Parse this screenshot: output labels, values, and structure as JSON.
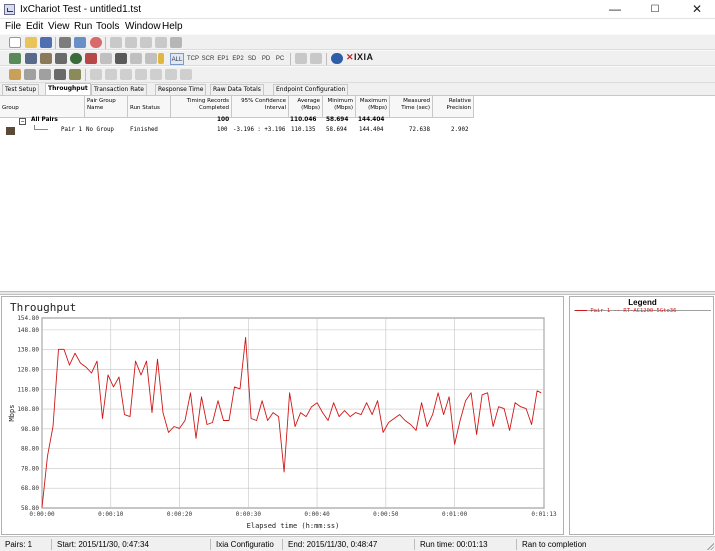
{
  "window": {
    "title": "IxChariot Test - untitled1.tst",
    "minimize": "—",
    "maximize": "☐",
    "close": "✕"
  },
  "menu": [
    "File",
    "Edit",
    "View",
    "Run",
    "Tools",
    "Window",
    "Help"
  ],
  "toolbar2": {
    "protocols": [
      "ALL",
      "TCP",
      "SCR",
      "EP1",
      "EP2",
      "SD",
      "PD",
      "PC"
    ],
    "brand": "IXIA"
  },
  "tabs": [
    "Test Setup",
    "Throughput",
    "Transaction Rate",
    "Response Time",
    "Raw Data Totals",
    "Endpoint Configuration"
  ],
  "table": {
    "headers": {
      "group": "Group",
      "pair_group_name": [
        "Pair Group",
        "Name"
      ],
      "run_status": "Run Status",
      "timing_records": [
        "Timing Records",
        "Completed"
      ],
      "confidence": [
        "95% Confidence",
        "Interval"
      ],
      "average": [
        "Average",
        "(Mbps)"
      ],
      "minimum": [
        "Minimum",
        "(Mbps)"
      ],
      "maximum": [
        "Maximum",
        "(Mbps)"
      ],
      "measured_time": [
        "Measured",
        "Time (sec)"
      ],
      "relative_precision": [
        "Relative",
        "Precision"
      ]
    },
    "all_pairs": {
      "label": "All Pairs",
      "timing_records": "100",
      "average": "110.046",
      "minimum": "58.694",
      "maximum": "144.404"
    },
    "rows": [
      {
        "group": "Pair 1",
        "pair_group_name": "No Group",
        "run_status": "Finished",
        "timing_records": "100",
        "confidence": "-3.196 : +3.196",
        "average": "110.135",
        "minimum": "58.694",
        "maximum": "144.404",
        "measured_time": "72.638",
        "relative_precision": "2.902"
      }
    ]
  },
  "chart_data": {
    "type": "line",
    "title": "Throughput",
    "xlabel": "Elapsed time (h:mm:ss)",
    "ylabel": "Mbps",
    "ylim": [
      58.8,
      154.8
    ],
    "yticks": [
      "58.80",
      "68.80",
      "78.80",
      "88.80",
      "98.80",
      "108.80",
      "118.80",
      "128.80",
      "138.80",
      "148.80",
      "154.80"
    ],
    "ytick_values": [
      58.8,
      68.8,
      78.8,
      88.8,
      98.8,
      108.8,
      118.8,
      128.8,
      138.8,
      148.8,
      154.8
    ],
    "xlim": [
      0,
      73
    ],
    "xticks": [
      "0:00:00",
      "0:00:10",
      "0:00:20",
      "0:00:30",
      "0:00:40",
      "0:00:50",
      "0:01:00",
      "0:01:13"
    ],
    "xtick_values": [
      0,
      10,
      20,
      30,
      40,
      50,
      60,
      73
    ],
    "grid": true,
    "line_color": "#d01818",
    "series": [
      {
        "name": "Pair 1 -- RT-AC1200-5G-to-36",
        "x": [
          0,
          0.8,
          1.6,
          2.4,
          3.2,
          4,
          4.8,
          5.6,
          6.4,
          7.2,
          8,
          8.8,
          9.6,
          10.4,
          11.2,
          12,
          12.8,
          13.6,
          14.4,
          15.2,
          16,
          16.8,
          17.6,
          18.4,
          19.2,
          20,
          20.8,
          21.6,
          22.4,
          23.2,
          24,
          24.8,
          25.6,
          26.4,
          27.2,
          28,
          28.8,
          29.6,
          30.4,
          31.2,
          32,
          32.8,
          33.6,
          34.4,
          35.2,
          36,
          36.8,
          37.6,
          38.4,
          39.2,
          40,
          40.8,
          41.6,
          42.4,
          43.2,
          44,
          44.8,
          45.6,
          46.4,
          47.2,
          48,
          48.8,
          49.6,
          50.4,
          51.2,
          52,
          52.8,
          53.6,
          54.4,
          55.2,
          56,
          56.8,
          57.6,
          58.4,
          59.2,
          60,
          60.8,
          61.6,
          62.4,
          63.2,
          64,
          64.8,
          65.6,
          66.4,
          67.2,
          68,
          68.8,
          69.6,
          70.4,
          71.2,
          72,
          72.6
        ],
        "values": [
          59,
          85,
          100,
          139,
          139,
          131,
          137,
          132,
          130,
          127,
          133,
          104,
          126,
          120,
          125,
          106,
          105,
          133,
          126,
          133,
          107,
          134,
          107,
          97,
          100,
          99,
          103,
          117,
          94,
          115,
          101,
          102,
          113,
          103,
          103,
          120,
          119,
          145,
          104,
          103,
          113,
          103,
          107,
          105,
          77,
          117,
          100,
          107,
          105,
          110,
          112,
          107,
          103,
          112,
          105,
          108,
          105,
          107,
          106,
          112,
          106,
          113,
          97,
          102,
          104,
          106,
          103,
          101,
          98,
          112,
          100,
          106,
          117,
          106,
          115,
          91,
          103,
          113,
          117,
          96,
          116,
          117,
          100,
          110,
          109,
          98,
          112,
          110,
          109,
          101,
          118,
          117
        ]
      }
    ]
  },
  "legend": {
    "title": "Legend",
    "entries": [
      "Pair 1 -- RT-AC1200-5Gto36"
    ]
  },
  "status": {
    "pairs": "Pairs: 1",
    "start": "Start: 2015/11/30, 0:47:34",
    "config": "Ixia Configuratio",
    "end": "End: 2015/11/30, 0:48:47",
    "run_time": "Run time: 00:01:13",
    "result": "Ran to completion"
  }
}
